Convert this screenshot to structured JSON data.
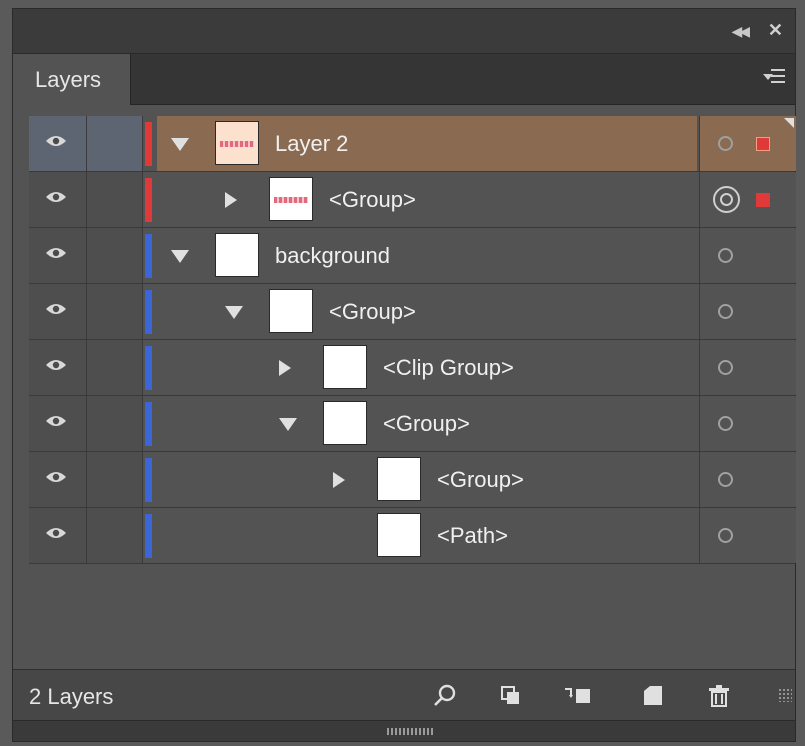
{
  "panel": {
    "tab_label": "Layers",
    "layer_count": "2 Layers"
  },
  "colors": {
    "layer2_color": "#e0393a",
    "background_color": "#3b67d6",
    "selected_row": "#8a6a50"
  },
  "icons": {
    "collapse": "double-left-arrow-icon",
    "close": "close-icon",
    "panel_menu": "panel-menu-icon",
    "eye": "eye-icon",
    "target": "target-circle-icon",
    "locate": "search-icon",
    "make_clip_mask": "clipping-mask-icon",
    "sublayer": "new-sublayer-icon",
    "new_layer": "new-layer-icon",
    "delete": "trash-icon"
  },
  "rows": [
    {
      "label": "Layer 2",
      "depth": 0,
      "arrow": "down",
      "color": "red",
      "selected": true,
      "active_target": false,
      "thumb": "peach"
    },
    {
      "label": "<Group>",
      "depth": 1,
      "arrow": "right",
      "color": "red",
      "selected": false,
      "active_target": true,
      "thumb": "bars"
    },
    {
      "label": "background",
      "depth": 0,
      "arrow": "down",
      "color": "blue",
      "selected": false,
      "active_target": false,
      "thumb": "white"
    },
    {
      "label": "<Group>",
      "depth": 1,
      "arrow": "down",
      "color": "blue",
      "selected": false,
      "active_target": false,
      "thumb": "white"
    },
    {
      "label": "<Clip Group>",
      "depth": 2,
      "arrow": "right",
      "color": "blue",
      "selected": false,
      "active_target": false,
      "thumb": "white"
    },
    {
      "label": "<Group>",
      "depth": 2,
      "arrow": "down",
      "color": "blue",
      "selected": false,
      "active_target": false,
      "thumb": "white"
    },
    {
      "label": "<Group>",
      "depth": 3,
      "arrow": "right",
      "color": "blue",
      "selected": false,
      "active_target": false,
      "thumb": "white"
    },
    {
      "label": "<Path>",
      "depth": 3,
      "arrow": "none",
      "color": "blue",
      "selected": false,
      "active_target": false,
      "thumb": "white"
    }
  ]
}
